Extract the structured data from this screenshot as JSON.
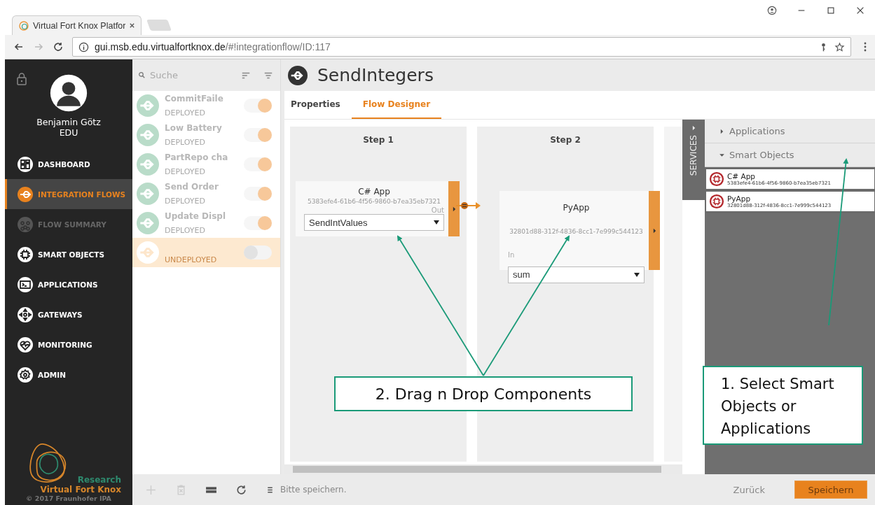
{
  "browser": {
    "tab_title": "Virtual Fort Knox Platfor",
    "url_host": "gui.msb.edu.virtualfortknox.de",
    "url_path": "/#!integrationflow/ID:117"
  },
  "user": {
    "name": "Benjamin Götz",
    "role": "EDU"
  },
  "nav": [
    {
      "label": "DASHBOARD",
      "kind": "dashboard",
      "selected": false,
      "disabled": false
    },
    {
      "label": "INTEGRATION FLOWS",
      "kind": "flow",
      "selected": true,
      "disabled": false
    },
    {
      "label": "FLOW SUMMARY",
      "kind": "network",
      "selected": false,
      "disabled": true
    },
    {
      "label": "SMART OBJECTS",
      "kind": "chip",
      "selected": false,
      "disabled": false
    },
    {
      "label": "APPLICATIONS",
      "kind": "terminal",
      "selected": false,
      "disabled": false
    },
    {
      "label": "GATEWAYS",
      "kind": "gateway",
      "selected": false,
      "disabled": false
    },
    {
      "label": "MONITORING",
      "kind": "heart",
      "selected": false,
      "disabled": false
    },
    {
      "label": "ADMIN",
      "kind": "gear",
      "selected": false,
      "disabled": false
    }
  ],
  "logo": {
    "tagline": "Research",
    "name": "Virtual Fort Knox",
    "copyright": "© 2017 Fraunhofer IPA"
  },
  "flow_list": {
    "search": {
      "placeholder": "Suche"
    },
    "items": [
      {
        "name": "CommitFaile",
        "status": "DEPLOYED",
        "on": true,
        "selected": false
      },
      {
        "name": "Low Battery",
        "status": "DEPLOYED",
        "on": true,
        "selected": false
      },
      {
        "name": "PartRepo cha",
        "status": "DEPLOYED",
        "on": true,
        "selected": false
      },
      {
        "name": "Send Order",
        "status": "DEPLOYED",
        "on": true,
        "selected": false
      },
      {
        "name": "Update Displ",
        "status": "DEPLOYED",
        "on": true,
        "selected": false
      },
      {
        "status": "UNDEPLOYED",
        "on": false,
        "selected": true
      }
    ]
  },
  "flow": {
    "title": "SendIntegers",
    "tabs": [
      {
        "label": "Properties",
        "selected": false
      },
      {
        "label": "Flow Designer",
        "selected": true
      }
    ],
    "steps": [
      {
        "title": "Step 1",
        "component": {
          "name": "C# App",
          "id": "5383efe4-61b6-4f56-9860-b7ea35eb7321",
          "port_label": "Out",
          "port_value": "SendIntValues"
        }
      },
      {
        "title": "Step 2",
        "component": {
          "name": "PyApp",
          "id": "32801d88-312f-4836-8cc1-7e999c544123",
          "port_label": "In",
          "port_value": "sum"
        }
      }
    ]
  },
  "services": {
    "tab_label": "SERVICES",
    "sections": [
      {
        "label": "Applications",
        "expanded": false
      },
      {
        "label": "Smart Objects",
        "expanded": true,
        "items": [
          {
            "name": "C# App",
            "id": "5383efe4-61b6-4f56-9860-b7ea35eb7321"
          },
          {
            "name": "PyApp",
            "id": "32801d88-312f-4836-8cc1-7e999c544123"
          }
        ]
      }
    ]
  },
  "footer": {
    "status": "Bitte speichern.",
    "back": "Zurück",
    "save": "Speichern"
  },
  "annotations": [
    {
      "text": "1. Select Smart Objects or Applications"
    },
    {
      "text": "2. Drag n Drop Components"
    }
  ]
}
